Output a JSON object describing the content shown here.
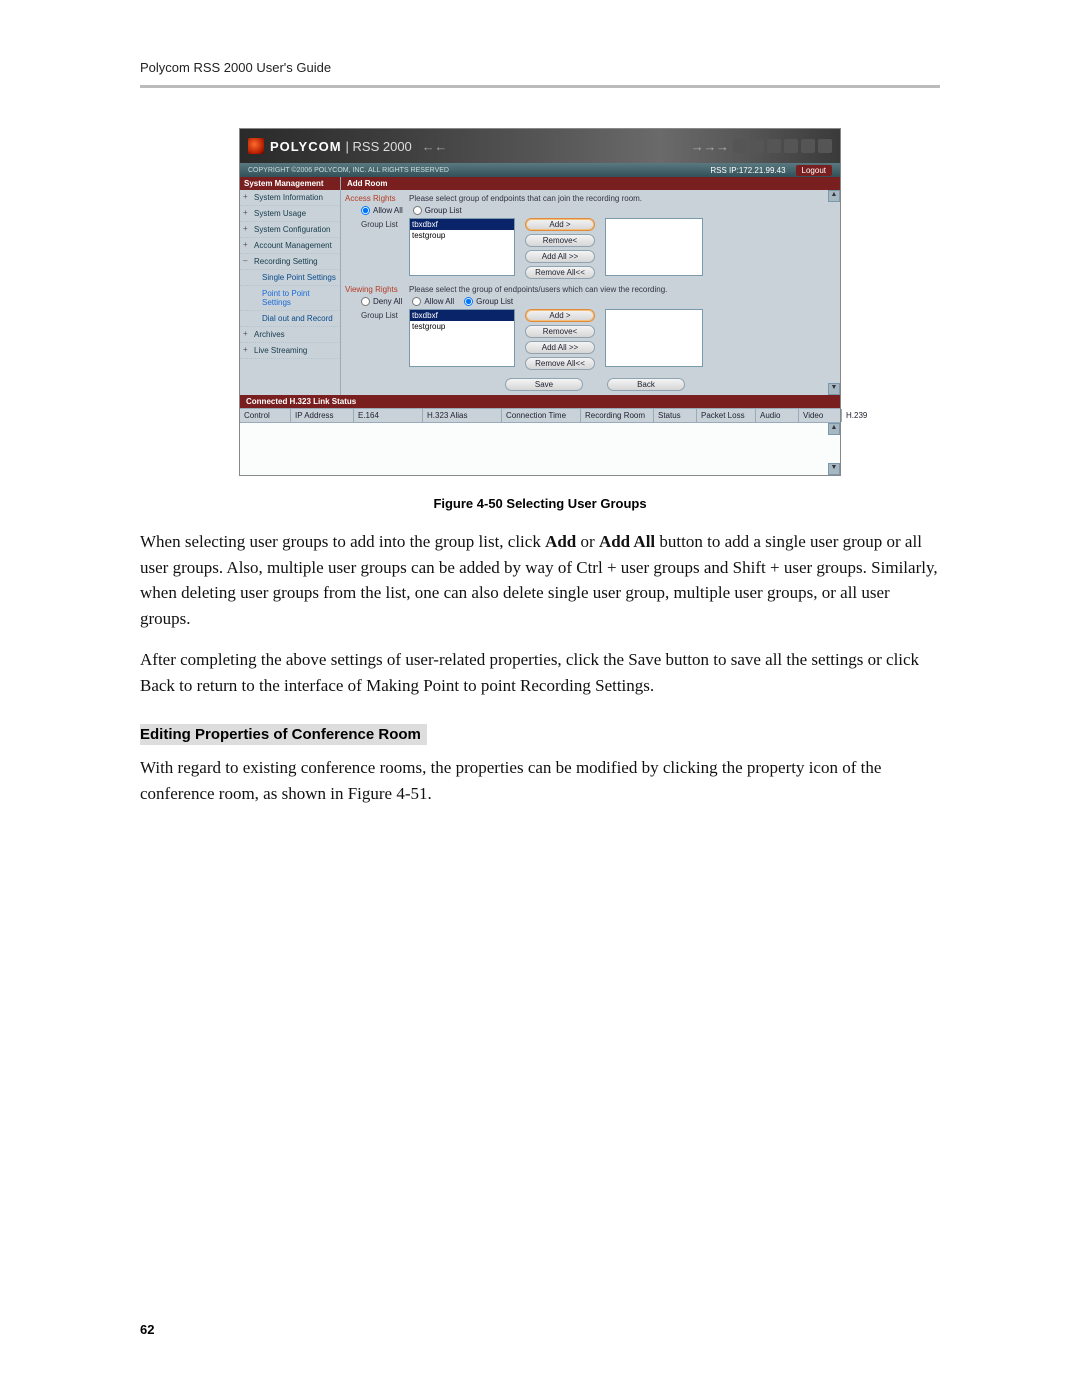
{
  "doc": {
    "header": "Polycom RSS 2000 User's Guide",
    "page_number": "62",
    "fig_caption": "Figure 4-50 Selecting User Groups",
    "para1_a": "When selecting user groups to add into the group list, click ",
    "para1_add": "Add",
    "para1_or": " or ",
    "para1_addall": "Add All",
    "para1_b": " button to add a single user group or all user groups. Also, multiple user groups can be added by way of Ctrl + user groups and Shift + user groups. Similarly, when deleting user groups from the list, one can also delete single user group, multiple user groups, or all user groups.",
    "para2": "After completing the above settings of user-related properties, click the Save button to save all the settings or click Back to return to the interface of Making Point to point Recording Settings.",
    "subhead": "Editing Properties of Conference Room",
    "para3": "With regard to existing conference rooms, the properties can be modified by clicking the property icon of the conference room, as shown in Figure 4-51."
  },
  "banner": {
    "brand": "POLYCOM",
    "brand_sub": "| RSS 2000",
    "arrows_left": "← ←",
    "arrows_right": "→ → →"
  },
  "topstrip": {
    "copyright": "COPYRIGHT ©2006 POLYCOM, INC. ALL RIGHTS RESERVED",
    "rssip": "RSS IP:172.21.99.43",
    "logout": "Logout"
  },
  "sidebar": {
    "title": "System Management",
    "items": [
      {
        "label": "System Information",
        "tog": "+"
      },
      {
        "label": "System Usage",
        "tog": "+"
      },
      {
        "label": "System Configuration",
        "tog": "+"
      },
      {
        "label": "Account Management",
        "tog": "+"
      },
      {
        "label": "Recording Setting",
        "tog": "–"
      }
    ],
    "subs": [
      {
        "label": "Single Point Settings"
      },
      {
        "label": "Point to Point Settings"
      },
      {
        "label": "Dial out and Record"
      }
    ],
    "items2": [
      {
        "label": "Archives",
        "tog": "+"
      },
      {
        "label": "Live Streaming",
        "tog": "+"
      }
    ]
  },
  "content": {
    "title": "Add Room",
    "access": {
      "label": "Access Rights",
      "desc": "Please select group of endpoints that can join the recording room.",
      "radios": {
        "allow_all": "Allow All",
        "group_list": "Group List"
      },
      "group_label": "Group List",
      "options": [
        "tbxdbxf",
        "testgroup"
      ],
      "btn_add": "Add >",
      "btn_remove": "Remove<",
      "btn_addall": "Add All >>",
      "btn_removeall": "Remove All<<"
    },
    "viewing": {
      "label": "Viewing Rights",
      "desc": "Please select the group of endpoints/users which can view the recording.",
      "radios": {
        "deny_all": "Deny All",
        "allow_all": "Allow All",
        "group_list": "Group List"
      },
      "group_label": "Group List",
      "options": [
        "tbxdbxf",
        "testgroup"
      ],
      "btn_add": "Add >",
      "btn_remove": "Remove<",
      "btn_addall": "Add All >>",
      "btn_removeall": "Remove All<<"
    },
    "save": "Save",
    "back": "Back"
  },
  "status": {
    "title": "Connected H.323 Link Status",
    "cols": [
      "Control",
      "IP Address",
      "E.164",
      "H.323 Alias",
      "Connection Time",
      "Recording Room",
      "Status",
      "Packet Loss",
      "Audio",
      "Video",
      "H.239"
    ]
  }
}
